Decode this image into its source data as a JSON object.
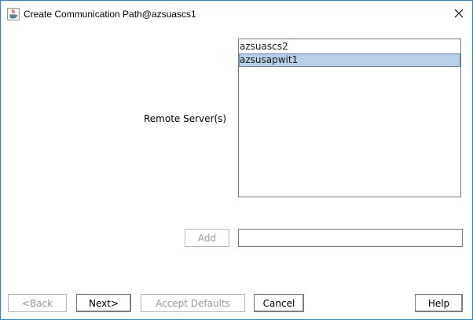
{
  "window": {
    "title": "Create Communication Path@azsuascs1"
  },
  "form": {
    "remote_servers_label": "Remote Server(s)",
    "servers": [
      {
        "name": "azsuascs2",
        "selected": false
      },
      {
        "name": "azsusapwit1",
        "selected": true
      }
    ],
    "add_button": "Add",
    "add_input_value": ""
  },
  "buttons": {
    "back": "<Back",
    "next": "Next>",
    "accept_defaults": "Accept Defaults",
    "cancel": "Cancel",
    "help": "Help"
  },
  "colors": {
    "selection_bg": "#b8cfe5",
    "selection_border": "#6382bf",
    "window_border": "#1e8ad6",
    "disabled_text": "#9a9a9a"
  },
  "icons": {
    "app": "java-cup-icon",
    "close": "close-icon"
  }
}
